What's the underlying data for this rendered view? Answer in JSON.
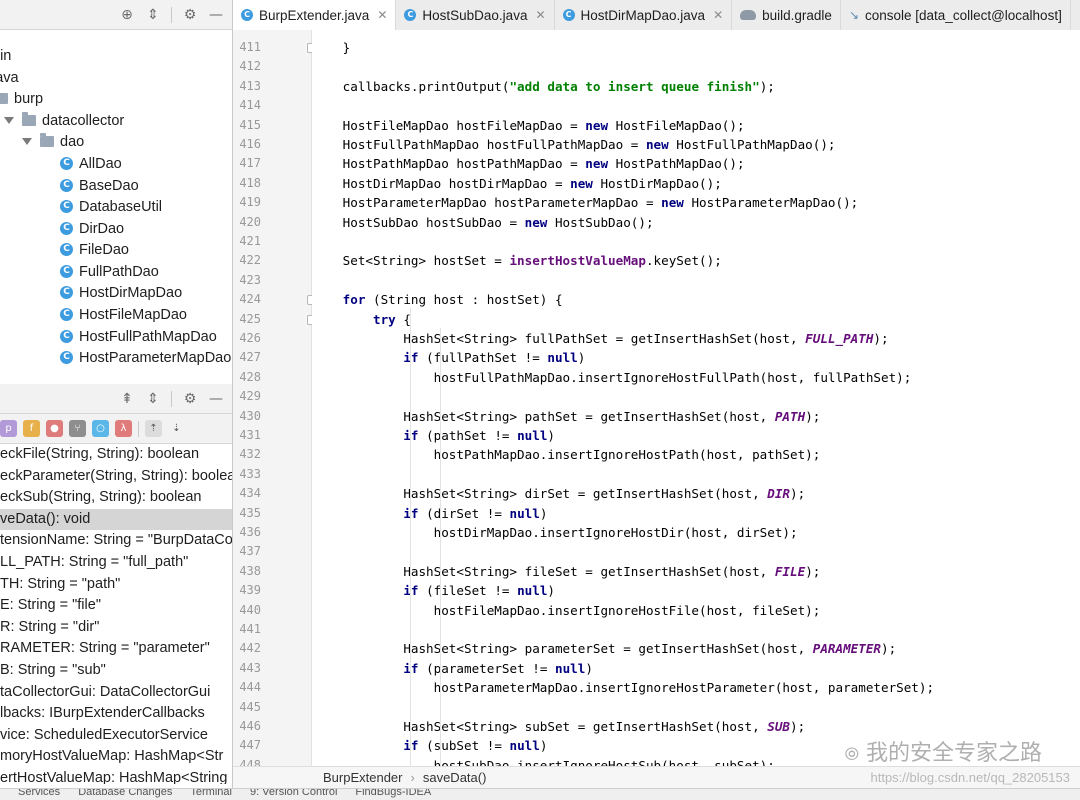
{
  "project_tree": {
    "items": [
      {
        "label": "ain",
        "kind": "folder"
      },
      {
        "label": "java",
        "kind": "folder"
      },
      {
        "label": "burp",
        "kind": "package"
      },
      {
        "label": "datacollector",
        "kind": "package"
      },
      {
        "label": "dao",
        "kind": "package"
      },
      {
        "label": "AllDao",
        "kind": "class"
      },
      {
        "label": "BaseDao",
        "kind": "class"
      },
      {
        "label": "DatabaseUtil",
        "kind": "class"
      },
      {
        "label": "DirDao",
        "kind": "class"
      },
      {
        "label": "FileDao",
        "kind": "class"
      },
      {
        "label": "FullPathDao",
        "kind": "class"
      },
      {
        "label": "HostDirMapDao",
        "kind": "class"
      },
      {
        "label": "HostFileMapDao",
        "kind": "class"
      },
      {
        "label": "HostFullPathMapDao",
        "kind": "class"
      },
      {
        "label": "HostParameterMapDao",
        "kind": "class"
      }
    ]
  },
  "structure": {
    "members": [
      "eckFile(String, String): boolean",
      "eckParameter(String, String): boolea",
      "eckSub(String, String): boolean",
      "veData(): void",
      "tensionName: String = \"BurpDataCo",
      "LL_PATH: String = \"full_path\"",
      "TH: String = \"path\"",
      "E: String = \"file\"",
      "R: String = \"dir\"",
      "RAMETER: String = \"parameter\"",
      "B: String = \"sub\"",
      "taCollectorGui: DataCollectorGui",
      "lbacks: IBurpExtenderCallbacks",
      "vice: ScheduledExecutorService",
      "moryHostValueMap: HashMap<Str",
      "ertHostValueMap: HashMap<String"
    ],
    "selected_index": 3
  },
  "tabs": [
    {
      "label": "BurpExtender.java",
      "icon": "class-icon",
      "active": true
    },
    {
      "label": "HostSubDao.java",
      "icon": "class-icon",
      "active": false
    },
    {
      "label": "HostDirMapDao.java",
      "icon": "class-icon",
      "active": false
    },
    {
      "label": "build.gradle",
      "icon": "gradle-icon",
      "active": false
    },
    {
      "label": "console [data_collect@localhost]",
      "icon": "console-icon",
      "active": false
    }
  ],
  "editor": {
    "lines": [
      {
        "n": "411",
        "code": [
          [
            "        }",
            ""
          ]
        ]
      },
      {
        "n": "412",
        "code": []
      },
      {
        "n": "413",
        "code": [
          [
            "        callbacks.printOutput(",
            ""
          ],
          [
            "\"add data to insert queue finish\"",
            "str"
          ],
          [
            ");",
            ""
          ]
        ]
      },
      {
        "n": "414",
        "code": []
      },
      {
        "n": "415",
        "code": [
          [
            "        HostFileMapDao hostFileMapDao = ",
            ""
          ],
          [
            "new",
            "kw"
          ],
          [
            " HostFileMapDao();",
            ""
          ]
        ]
      },
      {
        "n": "416",
        "code": [
          [
            "        HostFullPathMapDao hostFullPathMapDao = ",
            ""
          ],
          [
            "new",
            "kw"
          ],
          [
            " HostFullPathMapDao();",
            ""
          ]
        ]
      },
      {
        "n": "417",
        "code": [
          [
            "        HostPathMapDao hostPathMapDao = ",
            ""
          ],
          [
            "new",
            "kw"
          ],
          [
            " HostPathMapDao();",
            ""
          ]
        ]
      },
      {
        "n": "418",
        "code": [
          [
            "        HostDirMapDao hostDirMapDao = ",
            ""
          ],
          [
            "new",
            "kw"
          ],
          [
            " HostDirMapDao();",
            ""
          ]
        ]
      },
      {
        "n": "419",
        "code": [
          [
            "        HostParameterMapDao hostParameterMapDao = ",
            ""
          ],
          [
            "new",
            "kw"
          ],
          [
            " HostParameterMapDao();",
            ""
          ]
        ]
      },
      {
        "n": "420",
        "code": [
          [
            "        HostSubDao hostSubDao = ",
            ""
          ],
          [
            "new",
            "kw"
          ],
          [
            " HostSubDao();",
            ""
          ]
        ]
      },
      {
        "n": "421",
        "code": []
      },
      {
        "n": "422",
        "code": [
          [
            "        Set<String> hostSet = ",
            ""
          ],
          [
            "insertHostValueMap",
            "mth"
          ],
          [
            ".keySet();",
            ""
          ]
        ]
      },
      {
        "n": "423",
        "code": []
      },
      {
        "n": "424",
        "code": [
          [
            "        ",
            ""
          ],
          [
            "for",
            "kw"
          ],
          [
            " (String host : hostSet) {",
            ""
          ]
        ]
      },
      {
        "n": "425",
        "code": [
          [
            "            ",
            ""
          ],
          [
            "try",
            "kw"
          ],
          [
            " {",
            ""
          ]
        ]
      },
      {
        "n": "426",
        "code": [
          [
            "                HashSet<String> fullPathSet = getInsertHashSet(host, ",
            ""
          ],
          [
            "FULL_PATH",
            "fld"
          ],
          [
            ");",
            ""
          ]
        ]
      },
      {
        "n": "427",
        "code": [
          [
            "                ",
            ""
          ],
          [
            "if",
            "kw"
          ],
          [
            " (fullPathSet != ",
            ""
          ],
          [
            "null",
            "kw"
          ],
          [
            ")",
            ""
          ]
        ]
      },
      {
        "n": "428",
        "code": [
          [
            "                    hostFullPathMapDao.insertIgnoreHostFullPath(host, fullPathSet);",
            ""
          ]
        ]
      },
      {
        "n": "429",
        "code": []
      },
      {
        "n": "430",
        "code": [
          [
            "                HashSet<String> pathSet = getInsertHashSet(host, ",
            ""
          ],
          [
            "PATH",
            "fld"
          ],
          [
            ");",
            ""
          ]
        ]
      },
      {
        "n": "431",
        "code": [
          [
            "                ",
            ""
          ],
          [
            "if",
            "kw"
          ],
          [
            " (pathSet != ",
            ""
          ],
          [
            "null",
            "kw"
          ],
          [
            ")",
            ""
          ]
        ]
      },
      {
        "n": "432",
        "code": [
          [
            "                    hostPathMapDao.insertIgnoreHostPath(host, pathSet);",
            ""
          ]
        ]
      },
      {
        "n": "433",
        "code": []
      },
      {
        "n": "434",
        "code": [
          [
            "                HashSet<String> dirSet = getInsertHashSet(host, ",
            ""
          ],
          [
            "DIR",
            "fld"
          ],
          [
            ");",
            ""
          ]
        ]
      },
      {
        "n": "435",
        "code": [
          [
            "                ",
            ""
          ],
          [
            "if",
            "kw"
          ],
          [
            " (dirSet != ",
            ""
          ],
          [
            "null",
            "kw"
          ],
          [
            ")",
            ""
          ]
        ]
      },
      {
        "n": "436",
        "code": [
          [
            "                    hostDirMapDao.insertIgnoreHostDir(host, dirSet);",
            ""
          ]
        ]
      },
      {
        "n": "437",
        "code": []
      },
      {
        "n": "438",
        "code": [
          [
            "                HashSet<String> fileSet = getInsertHashSet(host, ",
            ""
          ],
          [
            "FILE",
            "fld"
          ],
          [
            ");",
            ""
          ]
        ]
      },
      {
        "n": "439",
        "code": [
          [
            "                ",
            ""
          ],
          [
            "if",
            "kw"
          ],
          [
            " (fileSet != ",
            ""
          ],
          [
            "null",
            "kw"
          ],
          [
            ")",
            ""
          ]
        ]
      },
      {
        "n": "440",
        "code": [
          [
            "                    hostFileMapDao.insertIgnoreHostFile(host, fileSet);",
            ""
          ]
        ]
      },
      {
        "n": "441",
        "code": []
      },
      {
        "n": "442",
        "code": [
          [
            "                HashSet<String> parameterSet = getInsertHashSet(host, ",
            ""
          ],
          [
            "PARAMETER",
            "fld"
          ],
          [
            ");",
            ""
          ]
        ]
      },
      {
        "n": "443",
        "code": [
          [
            "                ",
            ""
          ],
          [
            "if",
            "kw"
          ],
          [
            " (parameterSet != ",
            ""
          ],
          [
            "null",
            "kw"
          ],
          [
            ")",
            ""
          ]
        ]
      },
      {
        "n": "444",
        "code": [
          [
            "                    hostParameterMapDao.insertIgnoreHostParameter(host, parameterSet);",
            ""
          ]
        ]
      },
      {
        "n": "445",
        "code": []
      },
      {
        "n": "446",
        "code": [
          [
            "                HashSet<String> subSet = getInsertHashSet(host, ",
            ""
          ],
          [
            "SUB",
            "fld"
          ],
          [
            ");",
            ""
          ]
        ]
      },
      {
        "n": "447",
        "code": [
          [
            "                ",
            ""
          ],
          [
            "if",
            "kw"
          ],
          [
            " (subSet != ",
            ""
          ],
          [
            "null",
            "kw"
          ],
          [
            ")",
            ""
          ]
        ]
      },
      {
        "n": "448",
        "code": [
          [
            "                    hostSubDao.insertIgnoreHostSub(host, subSet);",
            ""
          ]
        ]
      }
    ]
  },
  "breadcrumbs": [
    "BurpExtender",
    "saveData()"
  ],
  "watermark": {
    "text": "我的安全专家之路",
    "url": "https://blog.csdn.net/qq_28205153"
  },
  "bottom_tools": [
    "Services",
    "Database Changes",
    "Terminal",
    "9: Version Control",
    "FindBugs-IDEA"
  ]
}
